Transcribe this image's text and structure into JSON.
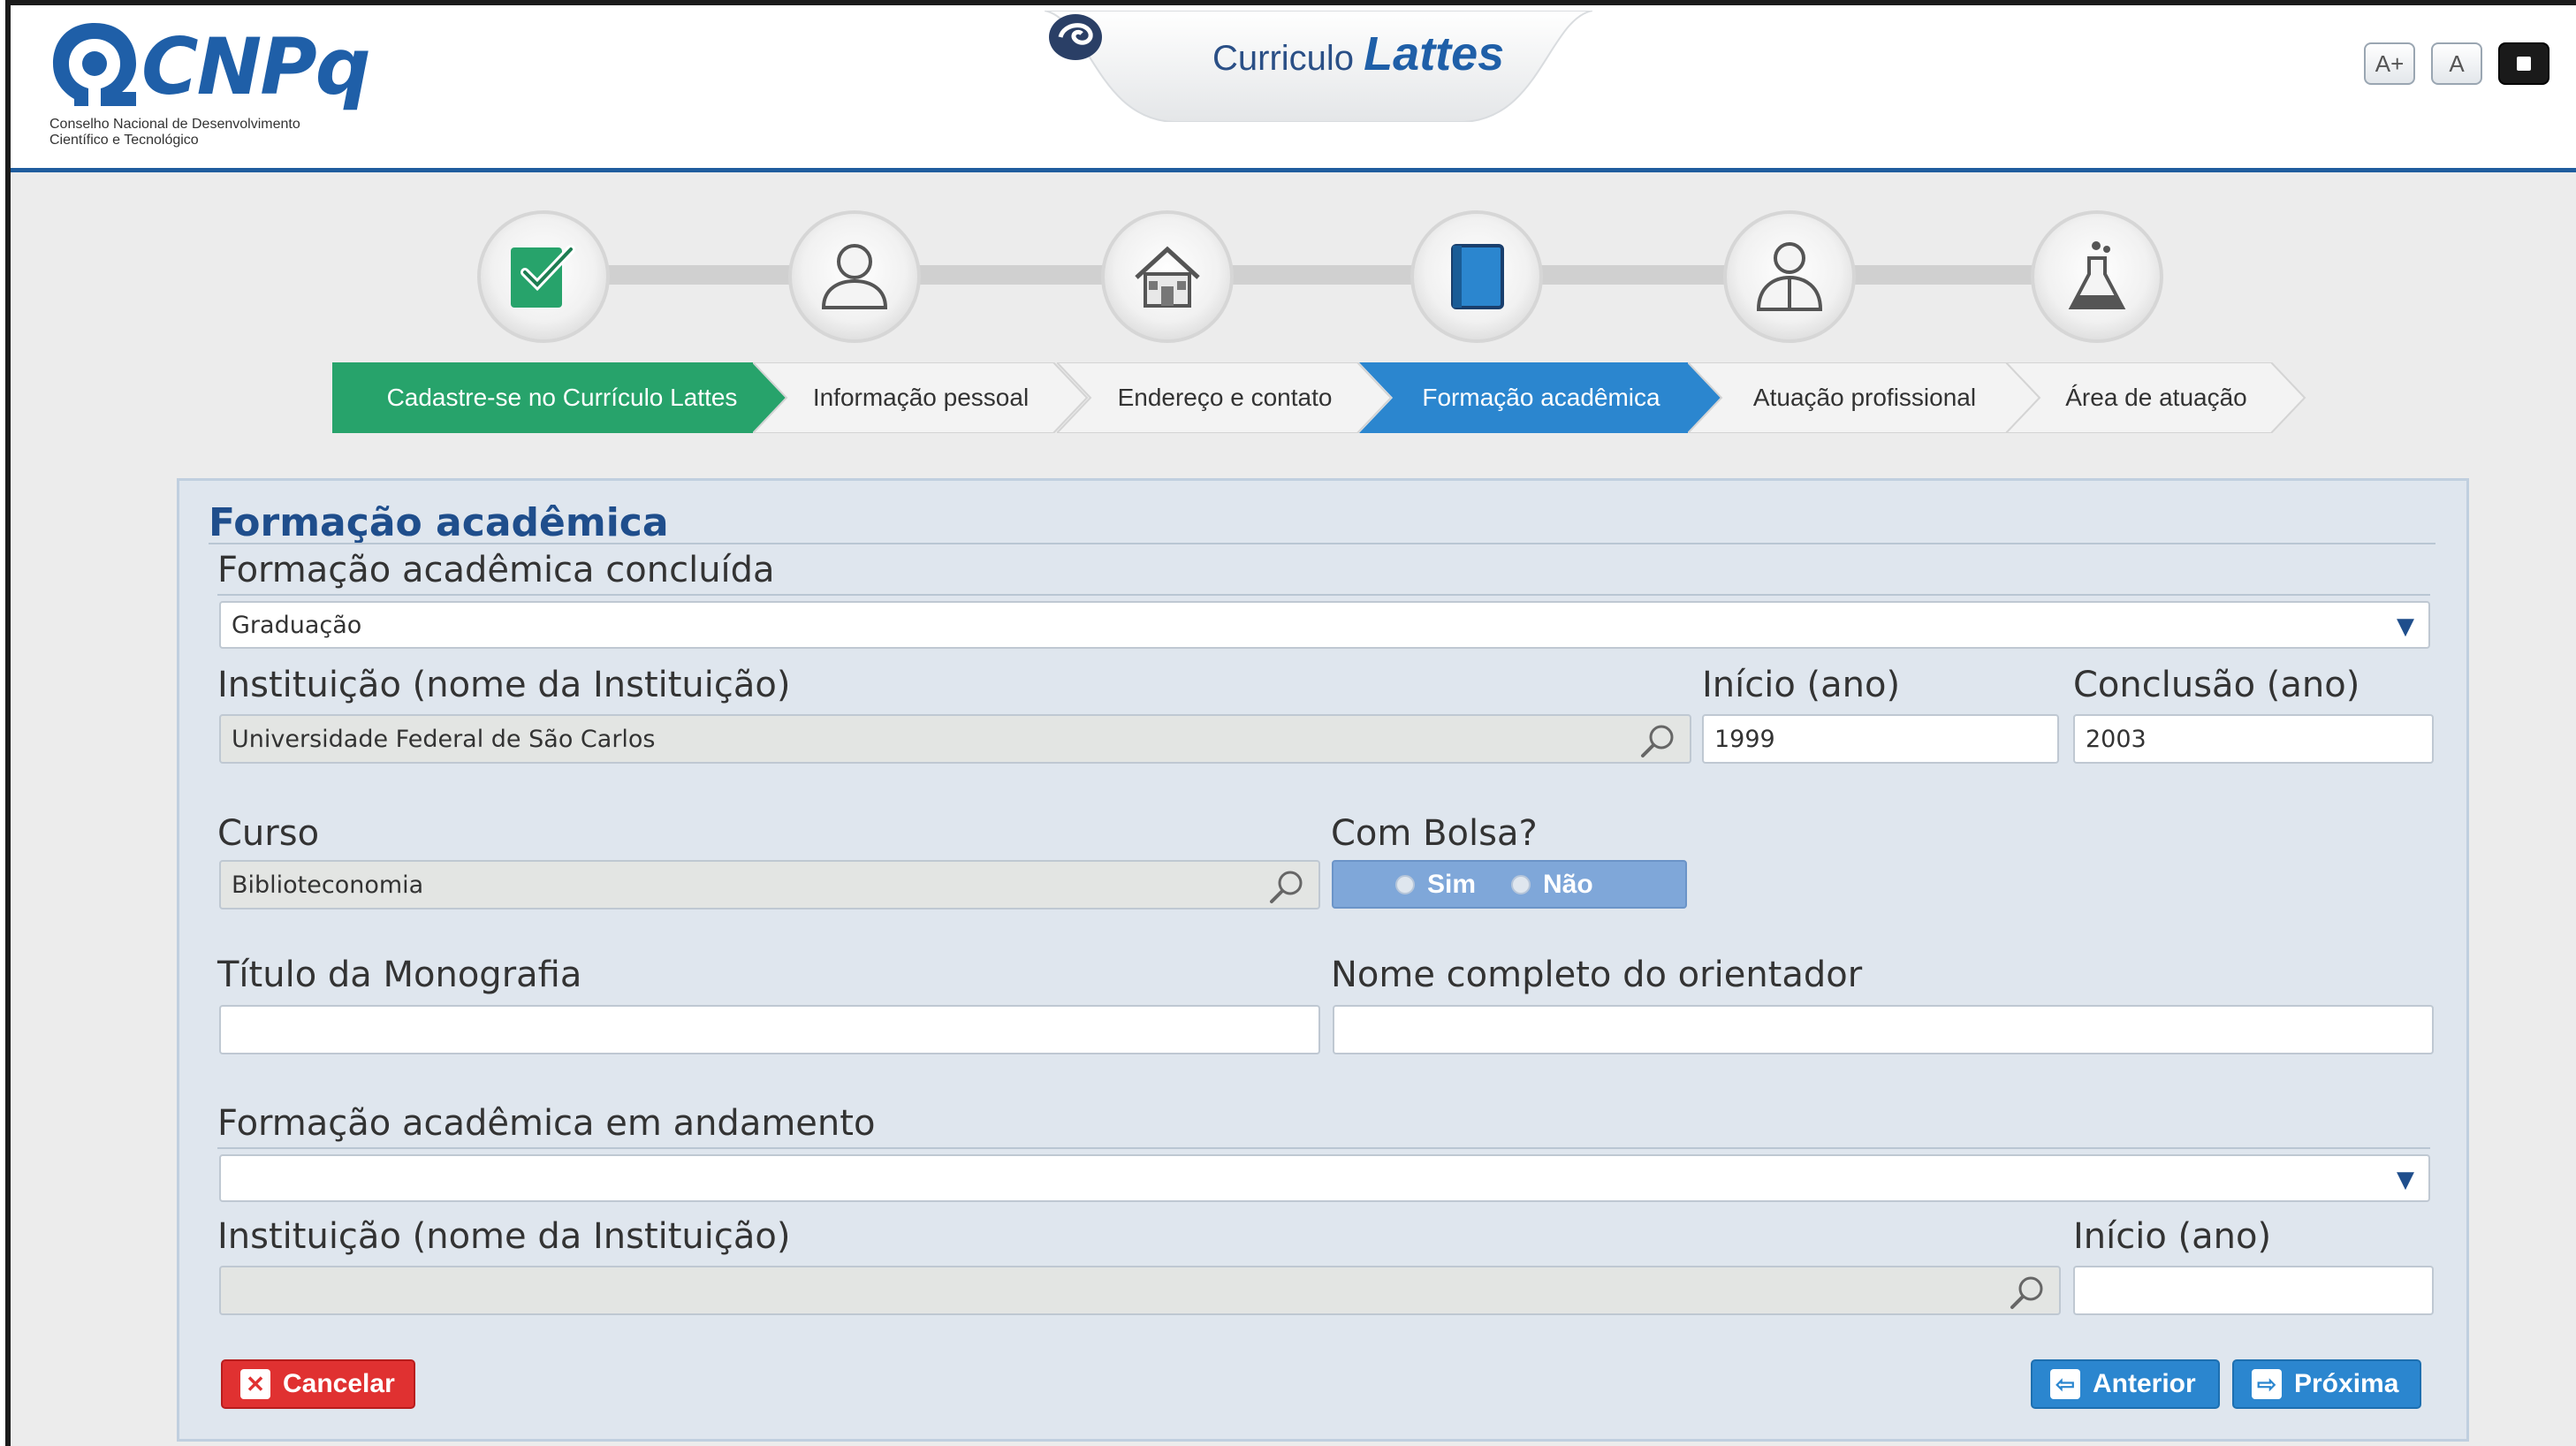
{
  "header": {
    "logo_name": "CNPq",
    "logo_subtitle_line1": "Conselho Nacional de Desenvolvimento",
    "logo_subtitle_line2": "Científico e Tecnológico",
    "brand_prefix": "Curriculo",
    "brand_name": "Lattes",
    "font_buttons": [
      "A+",
      "A",
      ""
    ]
  },
  "steps": {
    "icons": [
      "checkbox-form-icon",
      "person-icon",
      "house-icon",
      "book-icon",
      "professional-person-icon",
      "flask-icon"
    ],
    "labels": [
      "Cadastre-se no Currículo Lattes",
      "Informação pessoal",
      "Endereço e contato",
      "Formação acadêmica",
      "Atuação profissional",
      "Área de atuação"
    ],
    "active_colors": {
      "done": "#27a36b",
      "current": "#2b86cf"
    }
  },
  "form": {
    "title": "Formação acadêmica",
    "concluded": {
      "label": "Formação acadêmica concluída",
      "value": "Graduação"
    },
    "institution": {
      "label": "Instituição (nome da Instituição)",
      "value": "Universidade Federal de São Carlos"
    },
    "start_year": {
      "label": "Início (ano)",
      "value": "1999"
    },
    "end_year": {
      "label": "Conclusão (ano)",
      "value": "2003"
    },
    "course": {
      "label": "Curso",
      "value": "Biblioteconomia"
    },
    "scholarship": {
      "label": "Com Bolsa?",
      "options": [
        "Sim",
        "Não"
      ]
    },
    "monograph": {
      "label": "Título da Monografia",
      "value": ""
    },
    "advisor": {
      "label": "Nome completo do orientador",
      "value": ""
    },
    "in_progress": {
      "label": "Formação acadêmica em andamento",
      "value": ""
    },
    "institution2": {
      "label": "Instituição (nome da Instituição)",
      "value": ""
    },
    "start_year2": {
      "label": "Início (ano)",
      "value": ""
    }
  },
  "buttons": {
    "cancel": "Cancelar",
    "previous": "Anterior",
    "next": "Próxima"
  }
}
